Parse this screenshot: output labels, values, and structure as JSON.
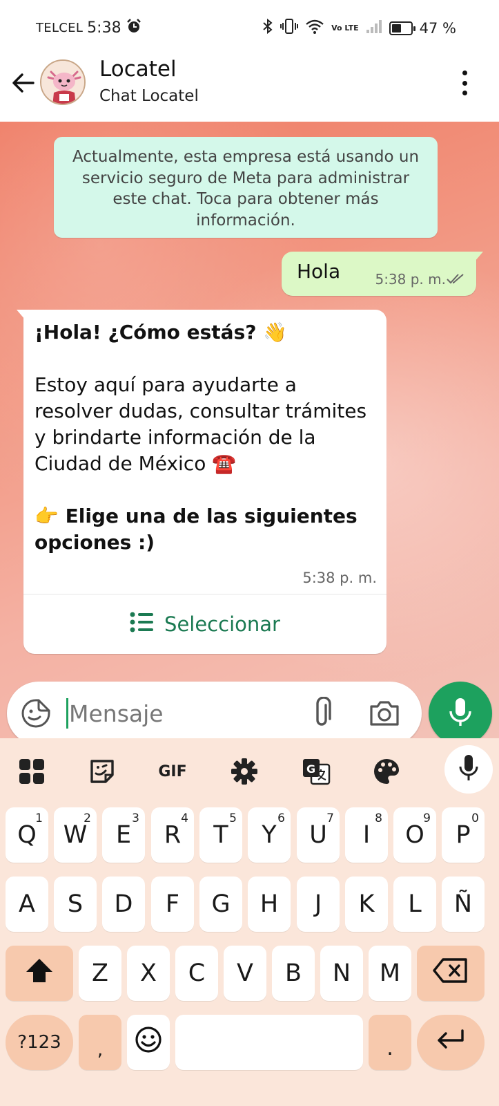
{
  "status_bar": {
    "carrier": "TELCEL",
    "time": "5:38",
    "battery_text": "47 %",
    "battery_level": 0.47,
    "network_label": "Vo LTE"
  },
  "header": {
    "title": "Locatel",
    "subtitle": "Chat Locatel"
  },
  "chat": {
    "notice": "Actualmente, esta empresa está usando un servicio seguro de Meta para administrar este chat. Toca para obtener más información.",
    "messages": [
      {
        "direction": "out",
        "text": "Hola",
        "time": "5:38 p. m."
      },
      {
        "direction": "in",
        "greeting": "¡Hola! ¿Cómo estás? 👋",
        "body": "Estoy aquí para ayudarte a resolver dudas, consultar trámites y brindarte información de la Ciudad de México ☎️",
        "prompt": "👉 Elige una de las siguientes opciones :)",
        "time": "5:38 p. m.",
        "button_label": "Seleccionar"
      }
    ]
  },
  "composer": {
    "placeholder": "Mensaje"
  },
  "keyboard": {
    "toolbar": [
      "apps-icon",
      "sticker-icon",
      "gif-icon",
      "settings-icon",
      "translate-icon",
      "theme-icon",
      "mic-icon"
    ],
    "gif_label": "GIF",
    "row1": [
      {
        "key": "Q",
        "hint": "1"
      },
      {
        "key": "W",
        "hint": "2"
      },
      {
        "key": "E",
        "hint": "3"
      },
      {
        "key": "R",
        "hint": "4"
      },
      {
        "key": "T",
        "hint": "5"
      },
      {
        "key": "Y",
        "hint": "6"
      },
      {
        "key": "U",
        "hint": "7"
      },
      {
        "key": "I",
        "hint": "8"
      },
      {
        "key": "O",
        "hint": "9"
      },
      {
        "key": "P",
        "hint": "0"
      }
    ],
    "row2": [
      "A",
      "S",
      "D",
      "F",
      "G",
      "H",
      "J",
      "K",
      "L",
      "Ñ"
    ],
    "row3": [
      "Z",
      "X",
      "C",
      "V",
      "B",
      "N",
      "M"
    ],
    "symbols_label": "?123",
    "comma": ",",
    "period": "."
  },
  "colors": {
    "accent_green": "#1da15e",
    "outgoing_bubble": "#dcf8c6",
    "notice_bubble": "#d4f8ea",
    "keyboard_bg": "#fbe6da",
    "function_key": "#f7c9ad"
  }
}
